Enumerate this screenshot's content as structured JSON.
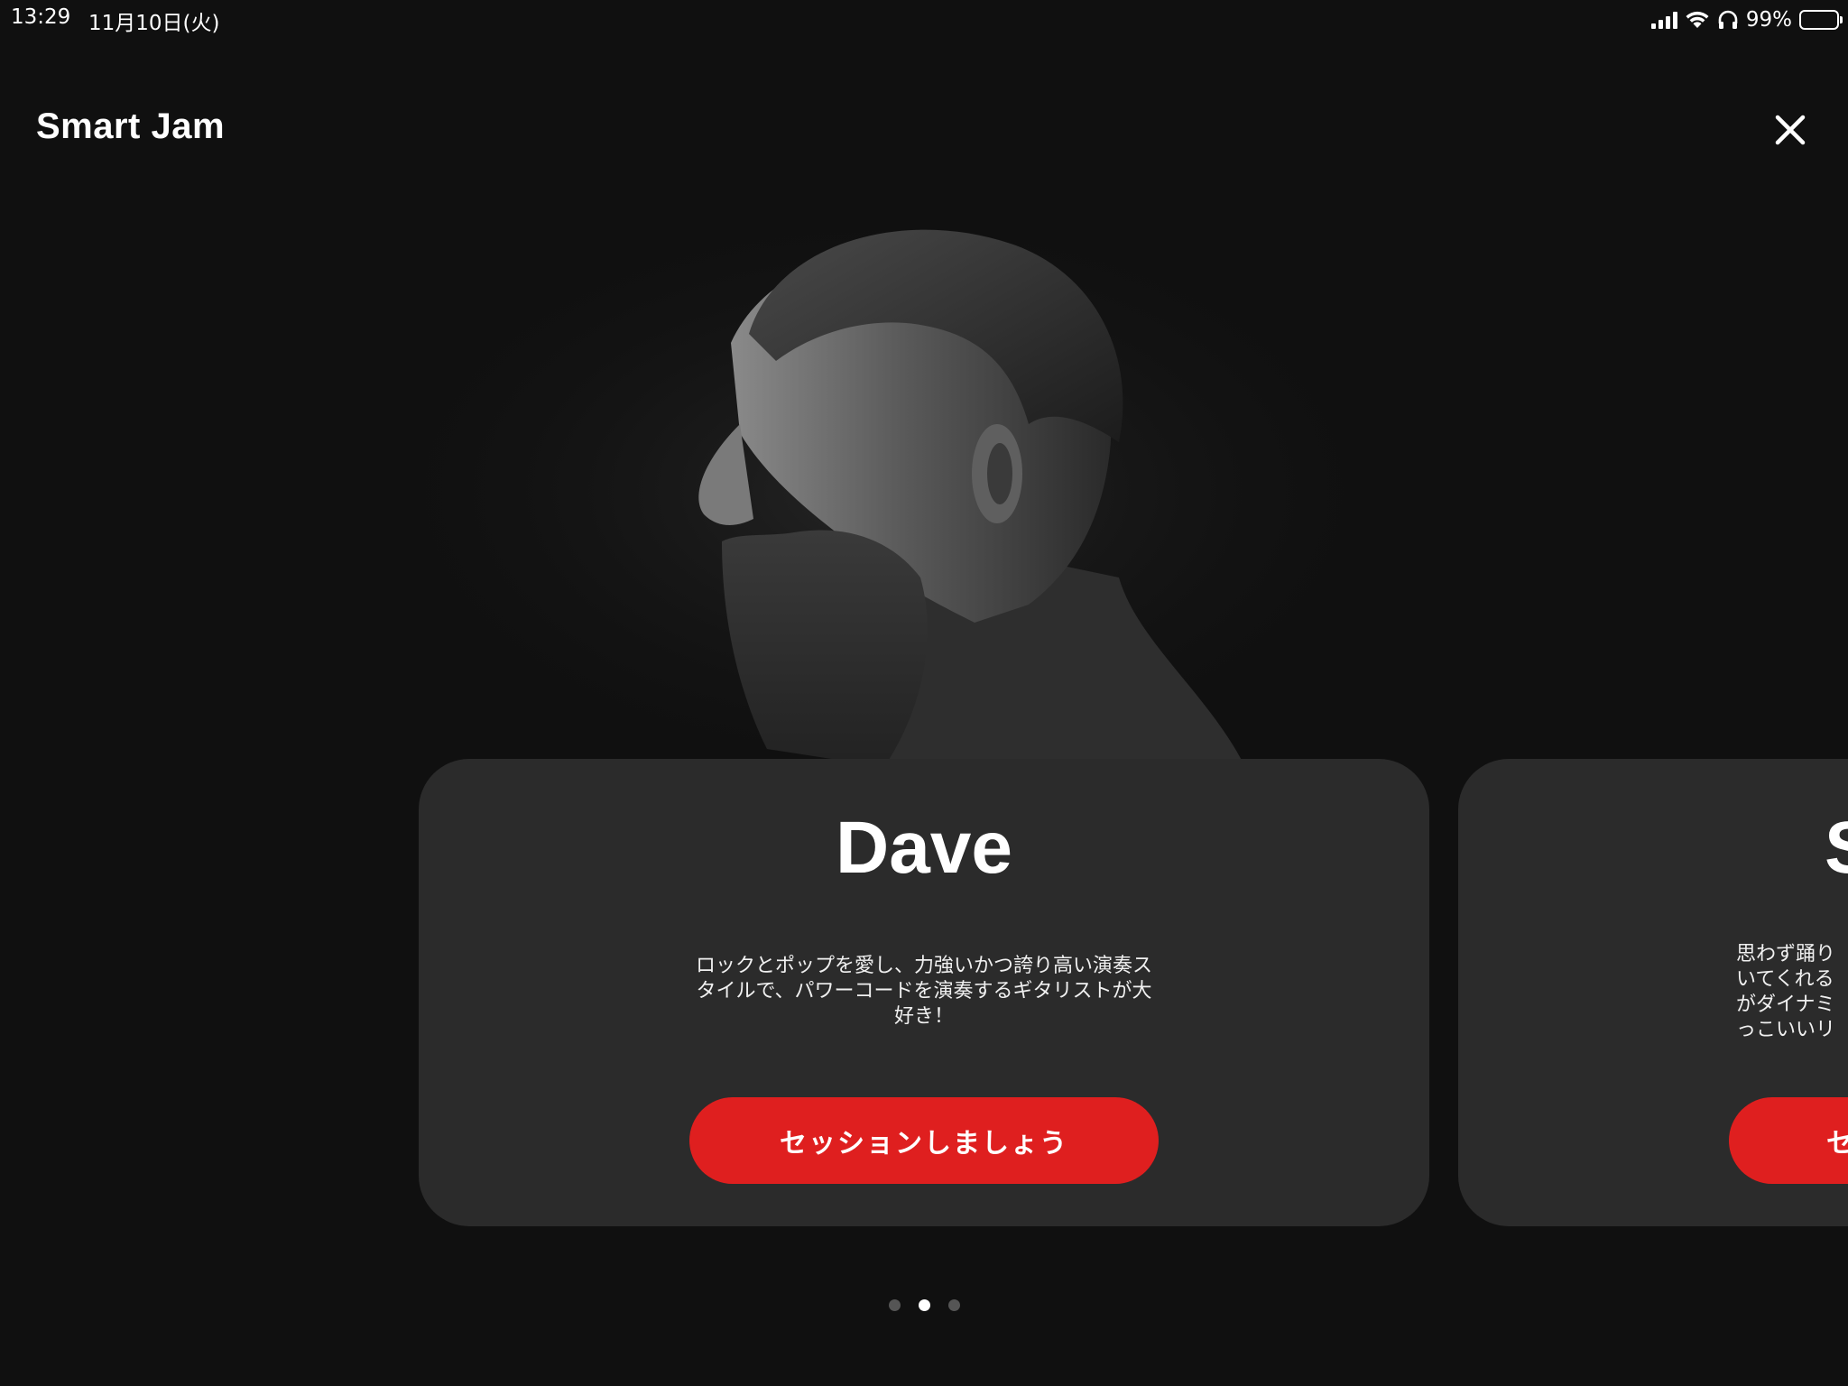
{
  "status_bar": {
    "time": "13:29",
    "date": "11月10日(火)",
    "battery_percent": "99%",
    "battery_level": 0.99
  },
  "header": {
    "title": "Smart Jam",
    "close_icon": "close-icon"
  },
  "carousel": {
    "active_index": 1,
    "page_count": 3,
    "cards": [
      {
        "name": "Dave",
        "description": "ロックとポップを愛し、力強いかつ誇り高い演奏スタイルで、パワーコードを演奏するギタリストが大好き！",
        "button_label": "セッションしましょう"
      },
      {
        "name_visible": "S",
        "description_lines_visible": [
          "思わず踊り",
          "いてくれる",
          "がダイナミ",
          "っこいいリ"
        ],
        "button_label_visible": "セ"
      }
    ]
  },
  "colors": {
    "background": "#101010",
    "card": "#2b2b2b",
    "accent": "#df1f1f",
    "dot_active": "#ffffff",
    "dot_inactive": "#555555"
  }
}
